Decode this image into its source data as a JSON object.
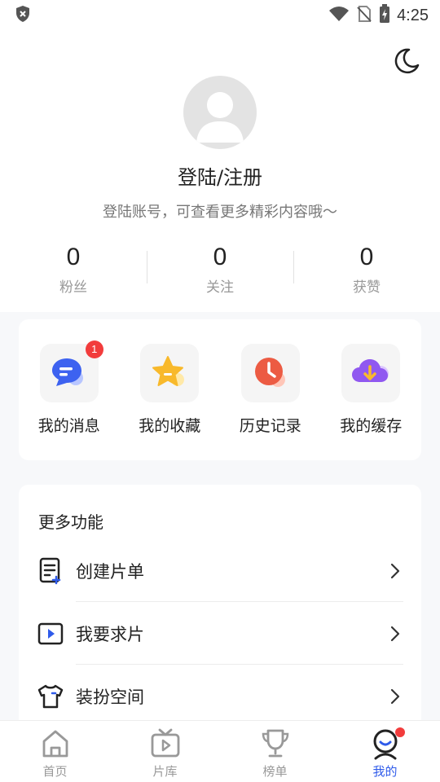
{
  "status_bar": {
    "time": "4:25",
    "icons": [
      "shield-icon",
      "wifi-icon",
      "no-sim-icon",
      "battery-charging-icon"
    ]
  },
  "header": {
    "theme_toggle_icon": "moon-icon",
    "login_title": "登陆/注册",
    "login_subtitle": "登陆账号，可查看更多精彩内容哦～"
  },
  "stats": [
    {
      "value": "0",
      "label": "粉丝"
    },
    {
      "value": "0",
      "label": "关注"
    },
    {
      "value": "0",
      "label": "获赞"
    }
  ],
  "quick_actions": [
    {
      "label": "我的消息",
      "icon": "message-icon",
      "badge": "1"
    },
    {
      "label": "我的收藏",
      "icon": "star-icon",
      "badge": ""
    },
    {
      "label": "历史记录",
      "icon": "clock-icon",
      "badge": ""
    },
    {
      "label": "我的缓存",
      "icon": "cloud-download-icon",
      "badge": ""
    }
  ],
  "more": {
    "title": "更多功能",
    "items": [
      {
        "label": "创建片单",
        "icon": "playlist-add-icon"
      },
      {
        "label": "我要求片",
        "icon": "video-request-icon"
      },
      {
        "label": "装扮空间",
        "icon": "shirt-icon"
      }
    ]
  },
  "tabbar": {
    "tabs": [
      {
        "label": "首页",
        "icon": "home-icon",
        "active": false
      },
      {
        "label": "片库",
        "icon": "tv-icon",
        "active": false
      },
      {
        "label": "榜单",
        "icon": "trophy-icon",
        "active": false
      },
      {
        "label": "我的",
        "icon": "profile-icon",
        "active": true
      }
    ]
  },
  "colors": {
    "accent": "#2f5bea",
    "badge": "#f23c3c",
    "background": "#f7f8fa"
  }
}
